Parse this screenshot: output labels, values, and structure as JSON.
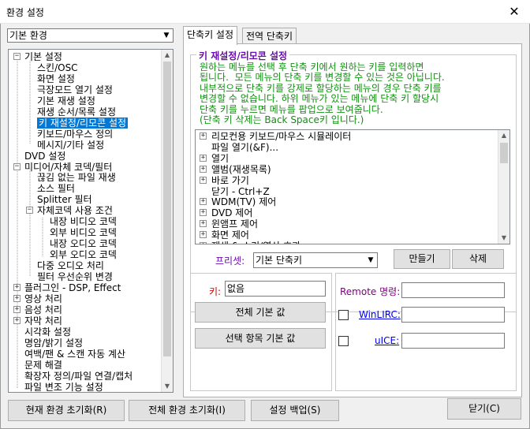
{
  "window": {
    "title": "환경 설정",
    "close_glyph": "✕"
  },
  "profile": {
    "selected": "기본 환경"
  },
  "tree": {
    "items": [
      {
        "label": "기본 설정",
        "expander": "−"
      },
      {
        "label": "스킨/OSC"
      },
      {
        "label": "화면 설정"
      },
      {
        "label": "극장모드 열기  설정"
      },
      {
        "label": "기본 재생 설정"
      },
      {
        "label": "재생 순서/목록 설정"
      },
      {
        "label": "키 재설정/리모콘 설정"
      },
      {
        "label": "키보드/마우스 정의"
      },
      {
        "label": "메시지/기타 설정"
      },
      {
        "label": "DVD 설정"
      },
      {
        "label": "미디어/자체 코덱/필터",
        "expander": "−"
      },
      {
        "label": "끊김 없는 파일 재생"
      },
      {
        "label": "소스 필터"
      },
      {
        "label": "Splitter 필터"
      },
      {
        "label": "자체코덱 사용 조건",
        "expander": "−"
      },
      {
        "label": "내장 비디오 코덱"
      },
      {
        "label": "외부 비디오 코덱"
      },
      {
        "label": "내장 오디오 코덱"
      },
      {
        "label": "외부 오디오 코덱"
      },
      {
        "label": "다중 오디오 처리"
      },
      {
        "label": "필터 우선순위 변경"
      },
      {
        "label": "플러그인 - DSP, Effect",
        "expander": "+"
      },
      {
        "label": "영상 처리",
        "expander": "+"
      },
      {
        "label": "음성 처리",
        "expander": "+"
      },
      {
        "label": "자막 처리",
        "expander": "+"
      },
      {
        "label": "시각화 설정"
      },
      {
        "label": "명암/밝기 설정"
      },
      {
        "label": "여백/팬 & 스캔 자동 계산"
      },
      {
        "label": "문제 해결"
      },
      {
        "label": "확장자 정의/파일 연결/캡처"
      },
      {
        "label": "파일 변조 기능 설정"
      }
    ]
  },
  "tabs": [
    {
      "label": "단축키 설정"
    },
    {
      "label": "전역 단축키"
    }
  ],
  "panel": {
    "group_title": "키 재설정/리모콘 설정",
    "description": "원하는 메뉴를 선택 후 단축 키에서 원하는 키를 입력하면\n됩니다.  모든 메뉴의 단축 키를 변경할 수 있는 것은 아닙니다.\n내부적으로 단축 키를 강제로 할당하는 메뉴의 경우 단축 키를\n변경할 수 없습니다. 하위 메뉴가 있는 메뉴에 단축 키 할당시\n단축 키를 누르면 메뉴를 팝업으로 보여줍니다.\n(단축 키 삭제는 Back Space키 입니다.)",
    "menu_items": [
      {
        "label": "리모컨용 키보드/마우스 시뮬레이터",
        "expander": "+"
      },
      {
        "label": "파일 열기(&F)..."
      },
      {
        "label": "열기",
        "expander": "+"
      },
      {
        "label": "앨범(재생목록)",
        "expander": "+"
      },
      {
        "label": "바로 가기",
        "expander": "+"
      },
      {
        "label": "닫기 - Ctrl+Z"
      },
      {
        "label": "WDM(TV) 제어",
        "expander": "+"
      },
      {
        "label": "DVD 제어",
        "expander": "+"
      },
      {
        "label": "윈앰프 제어",
        "expander": "+"
      },
      {
        "label": "화면 제어",
        "expander": "+"
      },
      {
        "label": "재생 & 소리/영상 효과",
        "expander": "+"
      }
    ],
    "preset_label": "프리셋:",
    "preset_value": "기본 단축키",
    "create_button": "만들기",
    "delete_button": "삭제",
    "key_label": "키:",
    "key_value": "없음",
    "all_default_button": "전체 기본 값",
    "selected_default_button": "선택 항목 기본 값",
    "remote_label": "Remote 명령:",
    "remote_value": "",
    "winlirc_label": "WinLIRC:",
    "winlirc_value": "",
    "uice_label": "uICE:",
    "uice_value": ""
  },
  "footer": {
    "reset_current": "현재 환경 초기화(R)",
    "reset_all": "전체 환경 초기화(I)",
    "backup": "설정 백업(S)",
    "close": "닫기(C)"
  },
  "colors": {
    "group_title": "#6a0dad",
    "description": "#109010",
    "key_label": "#cc0000",
    "remote_label": "#800080",
    "selection": "#0078d7"
  }
}
